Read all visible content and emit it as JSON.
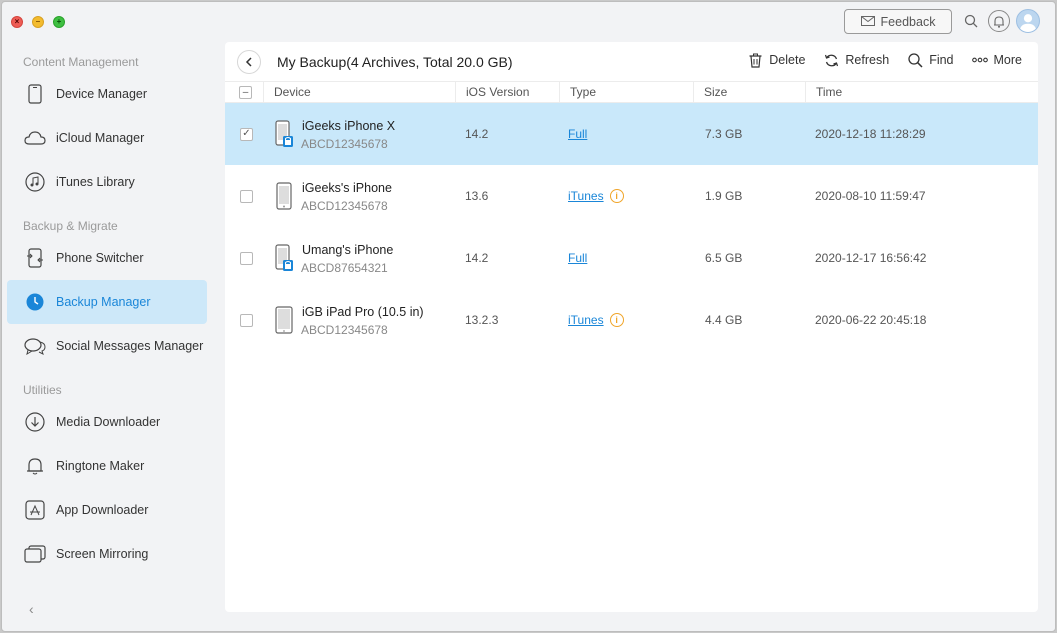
{
  "window": {
    "controls": [
      "close",
      "minimize",
      "maximize"
    ]
  },
  "topbar": {
    "feedback_label": "Feedback"
  },
  "sidebar": {
    "sections": [
      {
        "label": "Content Management"
      },
      {
        "label": "Backup & Migrate"
      },
      {
        "label": "Utilities"
      }
    ],
    "items": [
      {
        "label": "Device Manager",
        "icon": "phone-icon"
      },
      {
        "label": "iCloud Manager",
        "icon": "cloud-icon"
      },
      {
        "label": "iTunes Library",
        "icon": "music-icon"
      },
      {
        "label": "Phone Switcher",
        "icon": "phone-switch-icon"
      },
      {
        "label": "Backup Manager",
        "icon": "clock-icon",
        "active": true
      },
      {
        "label": "Social Messages Manager",
        "icon": "chat-icon"
      },
      {
        "label": "Media Downloader",
        "icon": "download-icon"
      },
      {
        "label": "Ringtone Maker",
        "icon": "bell-icon"
      },
      {
        "label": "App Downloader",
        "icon": "app-store-icon"
      },
      {
        "label": "Screen Mirroring",
        "icon": "mirror-icon"
      }
    ],
    "collapse_glyph": "‹"
  },
  "main": {
    "title": "My Backup(4 Archives, Total  20.0 GB)",
    "toolbar": {
      "delete_label": "Delete",
      "refresh_label": "Refresh",
      "find_label": "Find",
      "more_label": "More"
    },
    "table": {
      "columns": [
        "Device",
        "iOS Version",
        "Type",
        "Size",
        "Time"
      ],
      "rows": [
        {
          "name": "iGeeks iPhone X",
          "id": "ABCD12345678",
          "ios": "14.2",
          "type": "Full",
          "size": "7.3 GB",
          "time": "2020-12-18 11:28:29",
          "selected": true,
          "locked": true,
          "device": "iphone",
          "info": false
        },
        {
          "name": "iGeeks's iPhone",
          "id": "ABCD12345678",
          "ios": "13.6",
          "type": "iTunes",
          "size": "1.9 GB",
          "time": "2020-08-10 11:59:47",
          "selected": false,
          "locked": false,
          "device": "iphone",
          "info": true
        },
        {
          "name": "Umang's iPhone",
          "id": "ABCD87654321",
          "ios": "14.2",
          "type": "Full",
          "size": "6.5 GB",
          "time": "2020-12-17 16:56:42",
          "selected": false,
          "locked": true,
          "device": "iphone",
          "info": false
        },
        {
          "name": "iGB iPad Pro (10.5 in)",
          "id": "ABCD12345678",
          "ios": "13.2.3",
          "type": "iTunes",
          "size": "4.4 GB",
          "time": "2020-06-22 20:45:18",
          "selected": false,
          "locked": false,
          "device": "ipad",
          "info": true
        }
      ]
    }
  },
  "colors": {
    "accent": "#1a86d8",
    "selected_row": "#c9e8fa",
    "active_nav": "#cde8f9",
    "info": "#f0a52a"
  }
}
